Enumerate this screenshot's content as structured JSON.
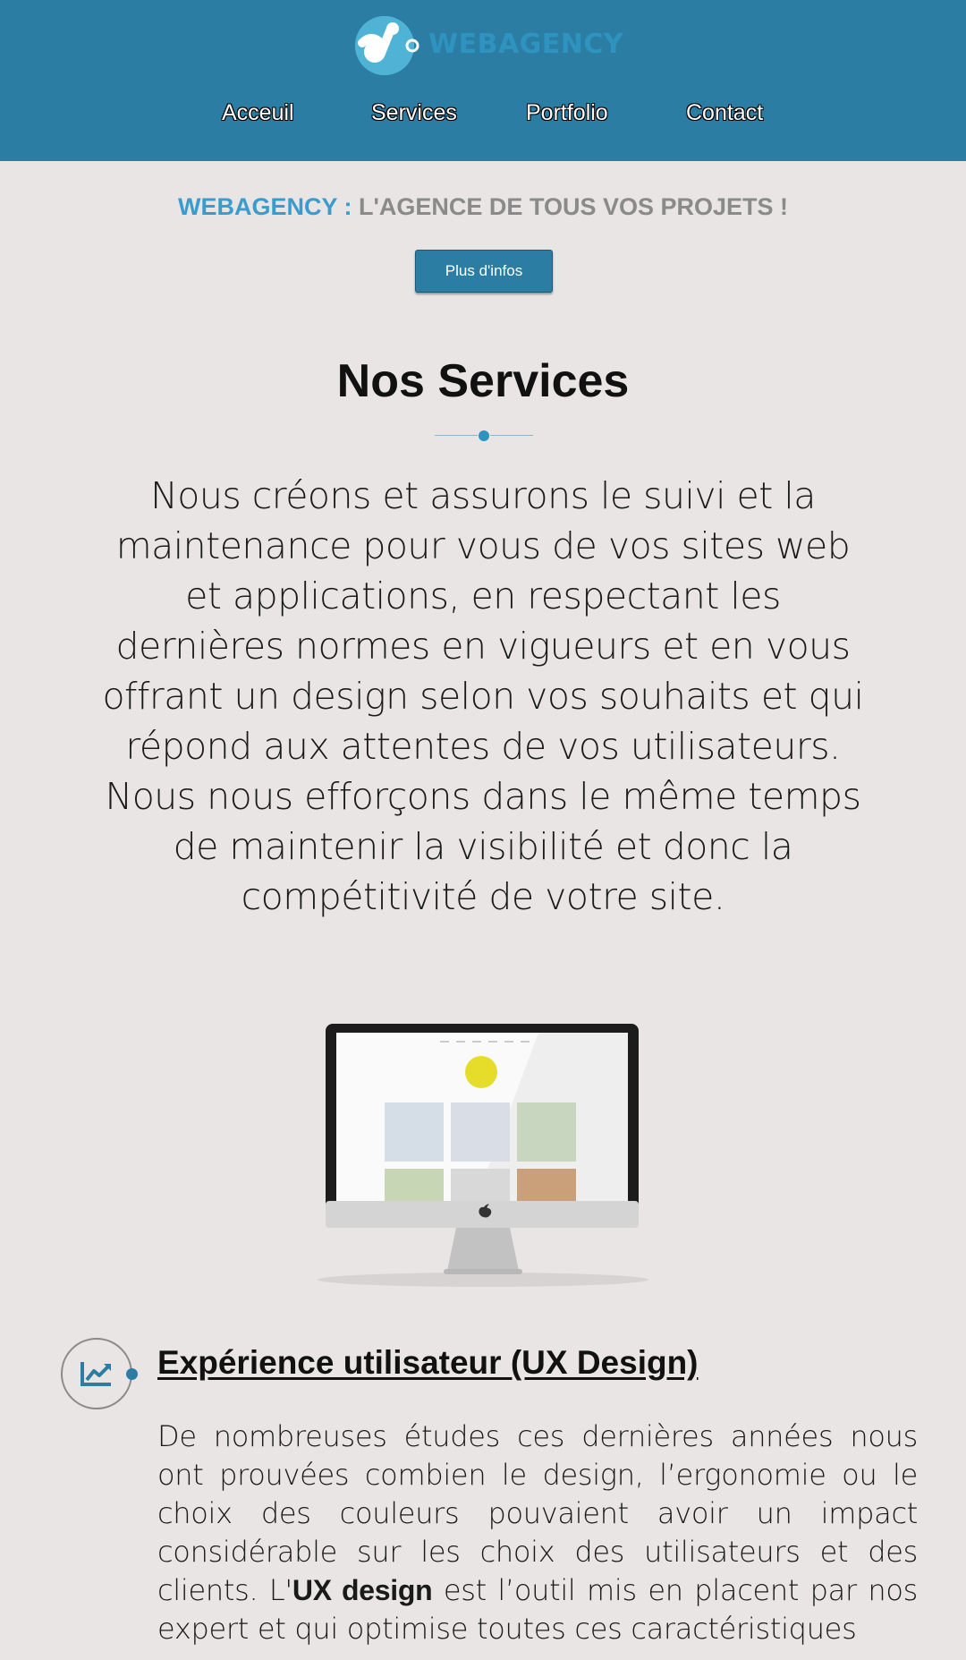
{
  "header": {
    "logo_text": "WEBAGENCY",
    "nav": [
      "Acceuil",
      "Services",
      "Portfolio",
      "Contact"
    ]
  },
  "hero": {
    "tagline_brand": "WEBAGENCY :",
    "tagline_rest": "L'AGENCE DE TOUS VOS PROJETS !",
    "button_label": "Plus d'infos"
  },
  "services": {
    "title": "Nos Services",
    "intro": "Nous créons et assurons le suivi et la maintenance pour vous de vos sites web et applications, en respectant les dernières normes en vigueurs et en vous offrant un design selon vos souhaits et qui répond aux attentes de vos utilisateurs. Nous nous efforçons dans le même temps de maintenir la visibilité et donc la compétitivité de votre site."
  },
  "feature": {
    "icon": "chart-line-icon",
    "title": "Expérience utilisateur (UX Design)",
    "text_before": "De nombreuses études ces dernières années nous ont prouvées combien le design, l’ergonomie ou le choix des couleurs pouvaient avoir un impact considérable sur les choix des utilisateurs et des clients. L'",
    "text_bold": "UX design",
    "text_after": " est l’outil mis en placent par nos expert et qui optimise toutes ces caractéristiques"
  },
  "colors": {
    "header_bg": "#2b7da3",
    "accent": "#3a9ccc",
    "page_bg": "#e8e5e4"
  }
}
